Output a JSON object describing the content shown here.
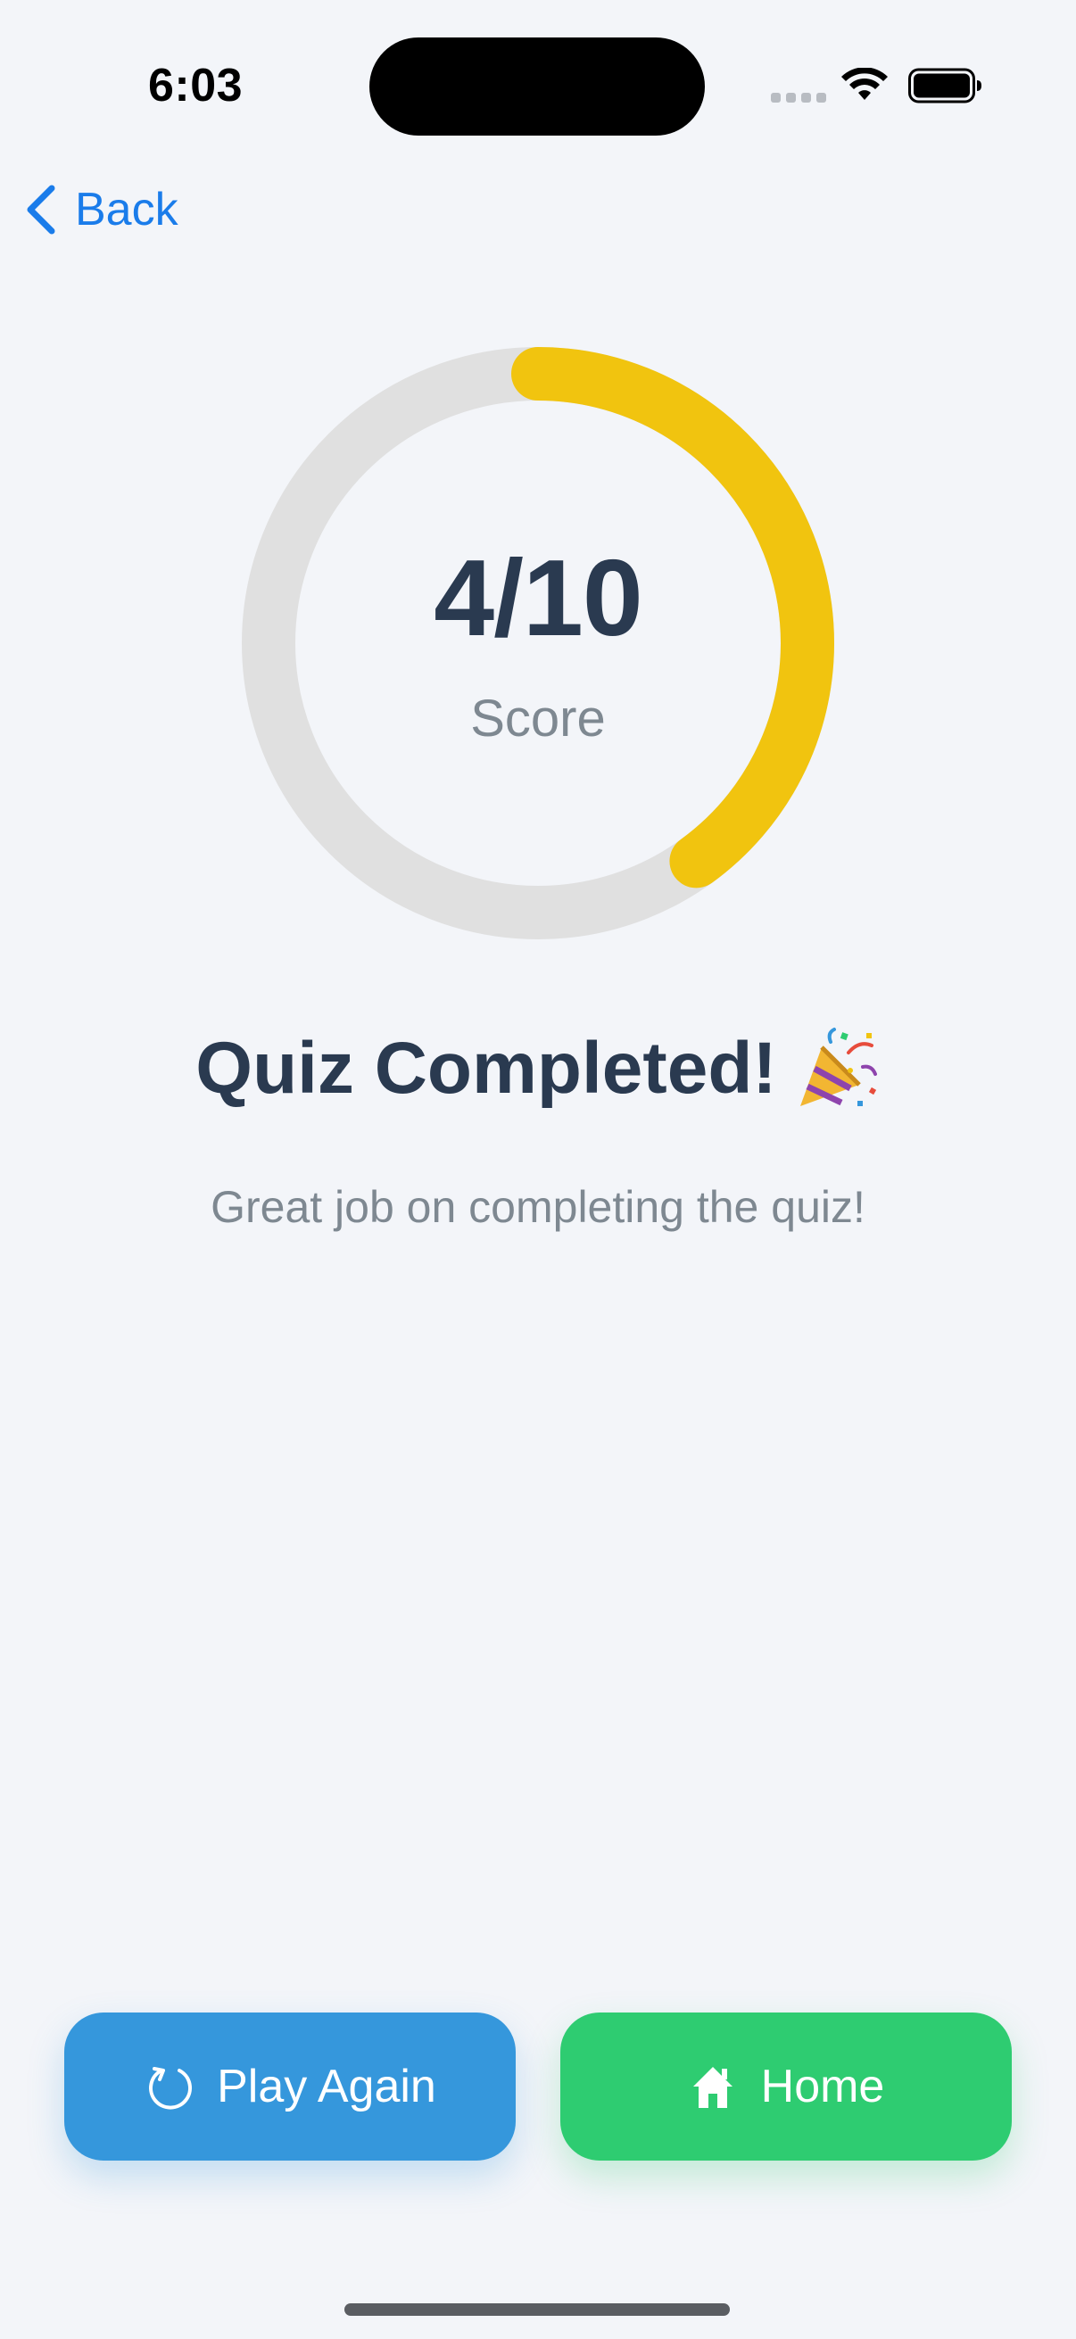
{
  "status_bar": {
    "time": "6:03"
  },
  "nav": {
    "back_label": "Back"
  },
  "score": {
    "value_text": "4/10",
    "label": "Score",
    "correct": 4,
    "total": 10
  },
  "result": {
    "title": "Quiz Completed!",
    "title_icon": "party-popper-icon",
    "subtitle": "Great job on completing the quiz!"
  },
  "actions": {
    "play_again_label": "Play Again",
    "play_again_icon": "refresh-icon",
    "home_label": "Home",
    "home_icon": "house-icon"
  },
  "colors": {
    "ring_track": "#e0e0e0",
    "ring_progress": "#f1c40f",
    "primary_text": "#2a3a50",
    "muted_text": "#7e8891",
    "link": "#1a7cea",
    "play_again_bg": "#3597dc",
    "home_bg": "#2ecc71",
    "background": "#f3f5f9"
  }
}
